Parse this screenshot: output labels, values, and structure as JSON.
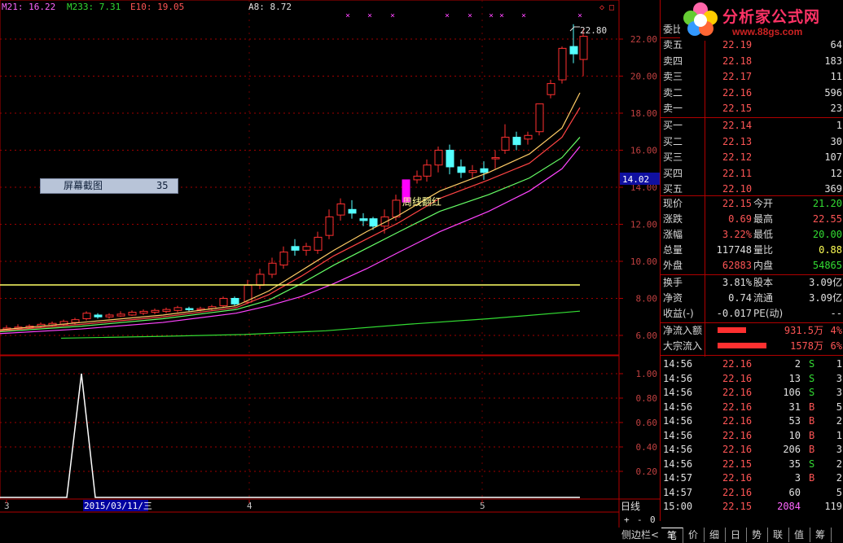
{
  "indicators": {
    "ma21": "M21: 16.22",
    "ma233": "M233: 7.31",
    "e10": "E10: 19.05",
    "a8": "A8: 8.72",
    "colors": {
      "ma21": "#ff66ff",
      "ma233": "#33dd33",
      "e10": "#ff4444",
      "a8": "#e0e0e0"
    }
  },
  "price_axis": {
    "ticks": [
      "22.00",
      "20.00",
      "18.00",
      "16.00",
      "14.00",
      "12.00",
      "10.00",
      "8.00",
      "6.00"
    ],
    "current": "14.02",
    "high_label": "22.80"
  },
  "sub_axis": {
    "ticks": [
      "1.00",
      "0.80",
      "0.60",
      "0.40",
      "0.20"
    ]
  },
  "date_axis": {
    "labels": [
      "3",
      "4",
      "5"
    ],
    "cursor_date": "2015/03/11/三"
  },
  "annotation": "周线翻红",
  "screenshot_popup": {
    "label": "屏幕截图",
    "value": "35"
  },
  "period_label": "日线",
  "zoom_buttons": {
    "plus": "+",
    "minus": "-",
    "zero": "0"
  },
  "logo": {
    "title": "分析家公式网",
    "url": "www.88gs.com"
  },
  "quote": {
    "wei_label": "委比",
    "asks": [
      {
        "label": "卖五",
        "price": "22.19",
        "vol": "64"
      },
      {
        "label": "卖四",
        "price": "22.18",
        "vol": "183"
      },
      {
        "label": "卖三",
        "price": "22.17",
        "vol": "11"
      },
      {
        "label": "卖二",
        "price": "22.16",
        "vol": "596"
      },
      {
        "label": "卖一",
        "price": "22.15",
        "vol": "23"
      }
    ],
    "bids": [
      {
        "label": "买一",
        "price": "22.14",
        "vol": "1"
      },
      {
        "label": "买二",
        "price": "22.13",
        "vol": "30"
      },
      {
        "label": "买三",
        "price": "22.12",
        "vol": "107"
      },
      {
        "label": "买四",
        "price": "22.11",
        "vol": "12"
      },
      {
        "label": "买五",
        "price": "22.10",
        "vol": "369"
      }
    ],
    "stats": [
      {
        "l1": "现价",
        "v1": "22.15",
        "l2": "今开",
        "v2": "21.20"
      },
      {
        "l1": "涨跌",
        "v1": "0.69",
        "l2": "最高",
        "v2": "22.55"
      },
      {
        "l1": "涨幅",
        "v1": "3.22%",
        "l2": "最低",
        "v2": "20.00"
      },
      {
        "l1": "总量",
        "v1": "117748",
        "l2": "量比",
        "v2": "0.88"
      },
      {
        "l1": "外盘",
        "v1": "62883",
        "l2": "内盘",
        "v2": "54865"
      }
    ],
    "stats2": [
      {
        "l1": "换手",
        "v1": "3.81%",
        "l2": "股本",
        "v2": "3.09亿"
      },
      {
        "l1": "净资",
        "v1": "0.74",
        "l2": "流通",
        "v2": "3.09亿"
      },
      {
        "l1": "收益(-)",
        "v1": "-0.017",
        "l2": "PE(动)",
        "v2": "--"
      }
    ],
    "flows": [
      {
        "label": "净流入额",
        "value": "931.5万",
        "pct": "4%",
        "bar": 0.35
      },
      {
        "label": "大宗流入",
        "value": "1578万",
        "pct": "6%",
        "bar": 0.6
      }
    ],
    "ticks": [
      {
        "t": "14:56",
        "p": "22.16",
        "v": "2",
        "s": "S",
        "n": "1"
      },
      {
        "t": "14:56",
        "p": "22.16",
        "v": "13",
        "s": "S",
        "n": "3"
      },
      {
        "t": "14:56",
        "p": "22.16",
        "v": "106",
        "s": "S",
        "n": "3"
      },
      {
        "t": "14:56",
        "p": "22.16",
        "v": "31",
        "s": "B",
        "n": "5"
      },
      {
        "t": "14:56",
        "p": "22.16",
        "v": "53",
        "s": "B",
        "n": "2"
      },
      {
        "t": "14:56",
        "p": "22.16",
        "v": "10",
        "s": "B",
        "n": "1"
      },
      {
        "t": "14:56",
        "p": "22.16",
        "v": "206",
        "s": "B",
        "n": "3"
      },
      {
        "t": "14:56",
        "p": "22.15",
        "v": "35",
        "s": "S",
        "n": "2"
      },
      {
        "t": "14:57",
        "p": "22.16",
        "v": "3",
        "s": "B",
        "n": "2"
      },
      {
        "t": "14:57",
        "p": "22.16",
        "v": "60",
        "s": "",
        "n": "5"
      },
      {
        "t": "15:00",
        "p": "22.15",
        "v": "2084",
        "s": "",
        "n": "119"
      }
    ]
  },
  "bottom_tabs": [
    "侧边栏<",
    "笔",
    "价",
    "细",
    "日",
    "势",
    "联",
    "值",
    "筹"
  ]
}
